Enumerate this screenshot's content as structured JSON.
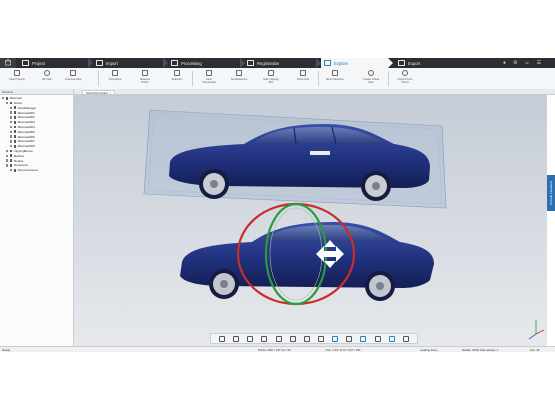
{
  "workflow": {
    "home_icon": "home-icon",
    "tabs": [
      {
        "label": "Project",
        "icon": "folder-icon"
      },
      {
        "label": "Import",
        "icon": "import-icon"
      },
      {
        "label": "Processing",
        "icon": "processing-icon"
      },
      {
        "label": "Registration",
        "icon": "registration-icon"
      },
      {
        "label": "Explore",
        "icon": "explore-icon"
      },
      {
        "label": "Export",
        "icon": "export-icon"
      }
    ],
    "active_tab": "Explore",
    "right_icons": [
      "help-icon",
      "settings-icon",
      "account-icon",
      "menu-icon"
    ]
  },
  "ribbon": {
    "items": [
      {
        "label": "View Projects",
        "icon": "cube-icon"
      },
      {
        "label": "3D View",
        "icon": "sphere-icon"
      },
      {
        "label": "Overview Map",
        "icon": "map-icon"
      },
      {
        "label": "Orthoplane",
        "icon": "orthoplane-icon"
      },
      {
        "label": "Measure Points",
        "icon": "measure-icon"
      },
      {
        "label": "Selection",
        "icon": "selection-icon"
      },
      {
        "label": "Save Screenshot",
        "icon": "screenshot-icon"
      },
      {
        "label": "Set Reference",
        "icon": "reference-icon"
      },
      {
        "label": "Hide Clipping Box",
        "icon": "clipping-box-icon"
      },
      {
        "label": "Show Grid",
        "icon": "grid-icon"
      },
      {
        "label": "Mesh Selection",
        "icon": "mesh-selection-icon"
      },
      {
        "label": "Create Virtual Scan",
        "icon": "virtual-scan-icon"
      },
      {
        "label": "Project Point Cloud",
        "icon": "point-cloud-icon"
      }
    ]
  },
  "tree": {
    "header": "Structure",
    "rows": [
      {
        "label": "Maxima2",
        "indent": 0,
        "icon": "project-icon"
      },
      {
        "label": "Scans",
        "indent": 1,
        "icon": "folder-icon"
      },
      {
        "label": "ScanManager",
        "indent": 2,
        "icon": "scan-icon"
      },
      {
        "label": "Maxima2001",
        "indent": 2,
        "icon": "scan-icon"
      },
      {
        "label": "Maxima2002",
        "indent": 2,
        "icon": "scan-icon"
      },
      {
        "label": "Maxima2003",
        "indent": 2,
        "icon": "scan-icon"
      },
      {
        "label": "Maxima2004",
        "indent": 2,
        "icon": "scan-icon"
      },
      {
        "label": "Maxima2005",
        "indent": 2,
        "icon": "scan-icon"
      },
      {
        "label": "Maxima2006",
        "indent": 2,
        "icon": "scan-icon"
      },
      {
        "label": "Maxima2007",
        "indent": 2,
        "icon": "scan-icon"
      },
      {
        "label": "Maxima2008",
        "indent": 2,
        "icon": "scan-icon"
      },
      {
        "label": "ClippingBoxes",
        "indent": 1,
        "icon": "clipping-box-icon"
      },
      {
        "label": "Meshes",
        "indent": 1,
        "icon": "mesh-icon"
      },
      {
        "label": "Models",
        "indent": 1,
        "icon": "model-icon"
      },
      {
        "label": "Viewpoints",
        "indent": 1,
        "icon": "viewpoint-icon"
      },
      {
        "label": "PersonCamera",
        "indent": 2,
        "icon": "camera-icon"
      }
    ]
  },
  "viewport": {
    "tab_label": "Scan Point Cloud",
    "feedback_label": "Provide Feedback"
  },
  "viewport_toolbar": {
    "icons": [
      "select-icon",
      "clip-icon",
      "zoom-icon",
      "view-icon",
      "ortho-icon",
      "pan-icon",
      "measure-icon",
      "fit-icon",
      "rotate-icon",
      "layers-icon",
      "render-icon",
      "settings-icon",
      "color-icon",
      "more-icon"
    ]
  },
  "status": {
    "left": "Ready",
    "middle": "Points: 2457 / 147 ms / 16",
    "coords": "Pos: 7.33 / 8.70 / 6.97 / 150",
    "loading": "Loading Done",
    "details": "Details: 100%  Sub-sample: 1",
    "fps": "Fps: 48"
  },
  "colors": {
    "workflow_bg": "#2b2f33",
    "accent": "#2a7fc0",
    "ring_red": "#c6302b",
    "ring_green": "#2a9a3a",
    "car_blue": "#233a8a"
  }
}
